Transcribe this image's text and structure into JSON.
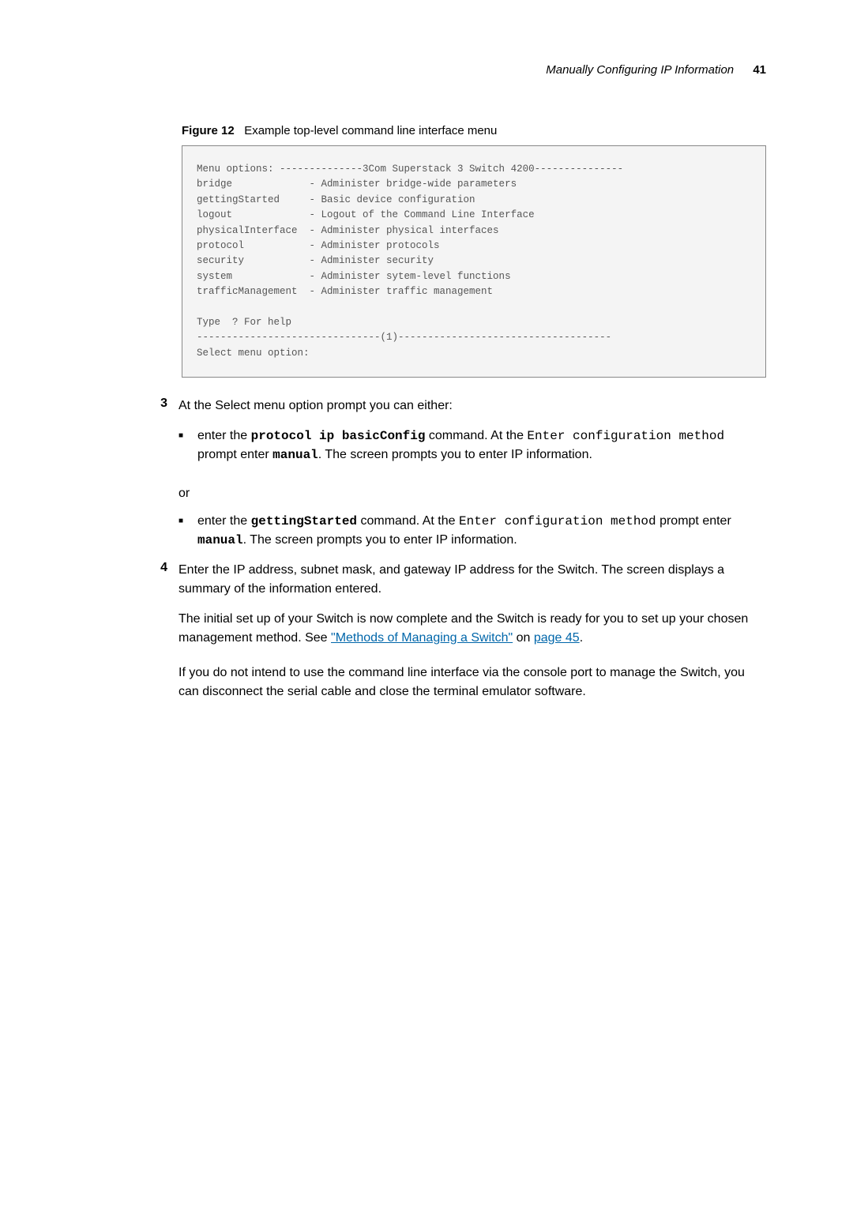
{
  "header": {
    "title": "Manually Configuring IP Information",
    "page_number": "41"
  },
  "figure": {
    "label": "Figure 12",
    "caption": "Example top-level command line interface menu",
    "code": "Menu options: --------------3Com Superstack 3 Switch 4200---------------\nbridge             - Administer bridge-wide parameters\ngettingStarted     - Basic device configuration\nlogout             - Logout of the Command Line Interface\nphysicalInterface  - Administer physical interfaces\nprotocol           - Administer protocols\nsecurity           - Administer security\nsystem             - Administer sytem-level functions\ntrafficManagement  - Administer traffic management\n\nType  ? For help\n-------------------------------(1)------------------------------------\nSelect menu option:"
  },
  "steps": {
    "s3": {
      "num": "3",
      "intro": "At the Select menu option prompt you can either:",
      "bullet1_a": "enter the ",
      "bullet1_cmd": "protocol ip basicConfig",
      "bullet1_b": " command. At the ",
      "bullet1_c": "Enter configuration method",
      "bullet1_d": " prompt enter ",
      "bullet1_e": "manual",
      "bullet1_f": ". The screen prompts you to enter IP information.",
      "or": "or",
      "bullet2_a": "enter the ",
      "bullet2_cmd": "gettingStarted",
      "bullet2_b": " command. At the ",
      "bullet2_c": "Enter configuration method",
      "bullet2_d": " prompt enter ",
      "bullet2_e": "manual",
      "bullet2_f": ". The screen prompts you to enter IP information."
    },
    "s4": {
      "num": "4",
      "text": "Enter the IP address, subnet mask, and gateway IP address for the Switch. The screen displays a summary of the information entered."
    }
  },
  "para1_a": "The initial set up of your Switch is now complete and the Switch is ready for you to set up your chosen management method. See ",
  "para1_link1": "\"Methods of Managing a Switch\"",
  "para1_b": " on ",
  "para1_link2": "page 45",
  "para1_c": ".",
  "para2": "If you do not intend to use the command line interface via the console port to manage the Switch, you can disconnect the serial cable and close the terminal emulator software."
}
